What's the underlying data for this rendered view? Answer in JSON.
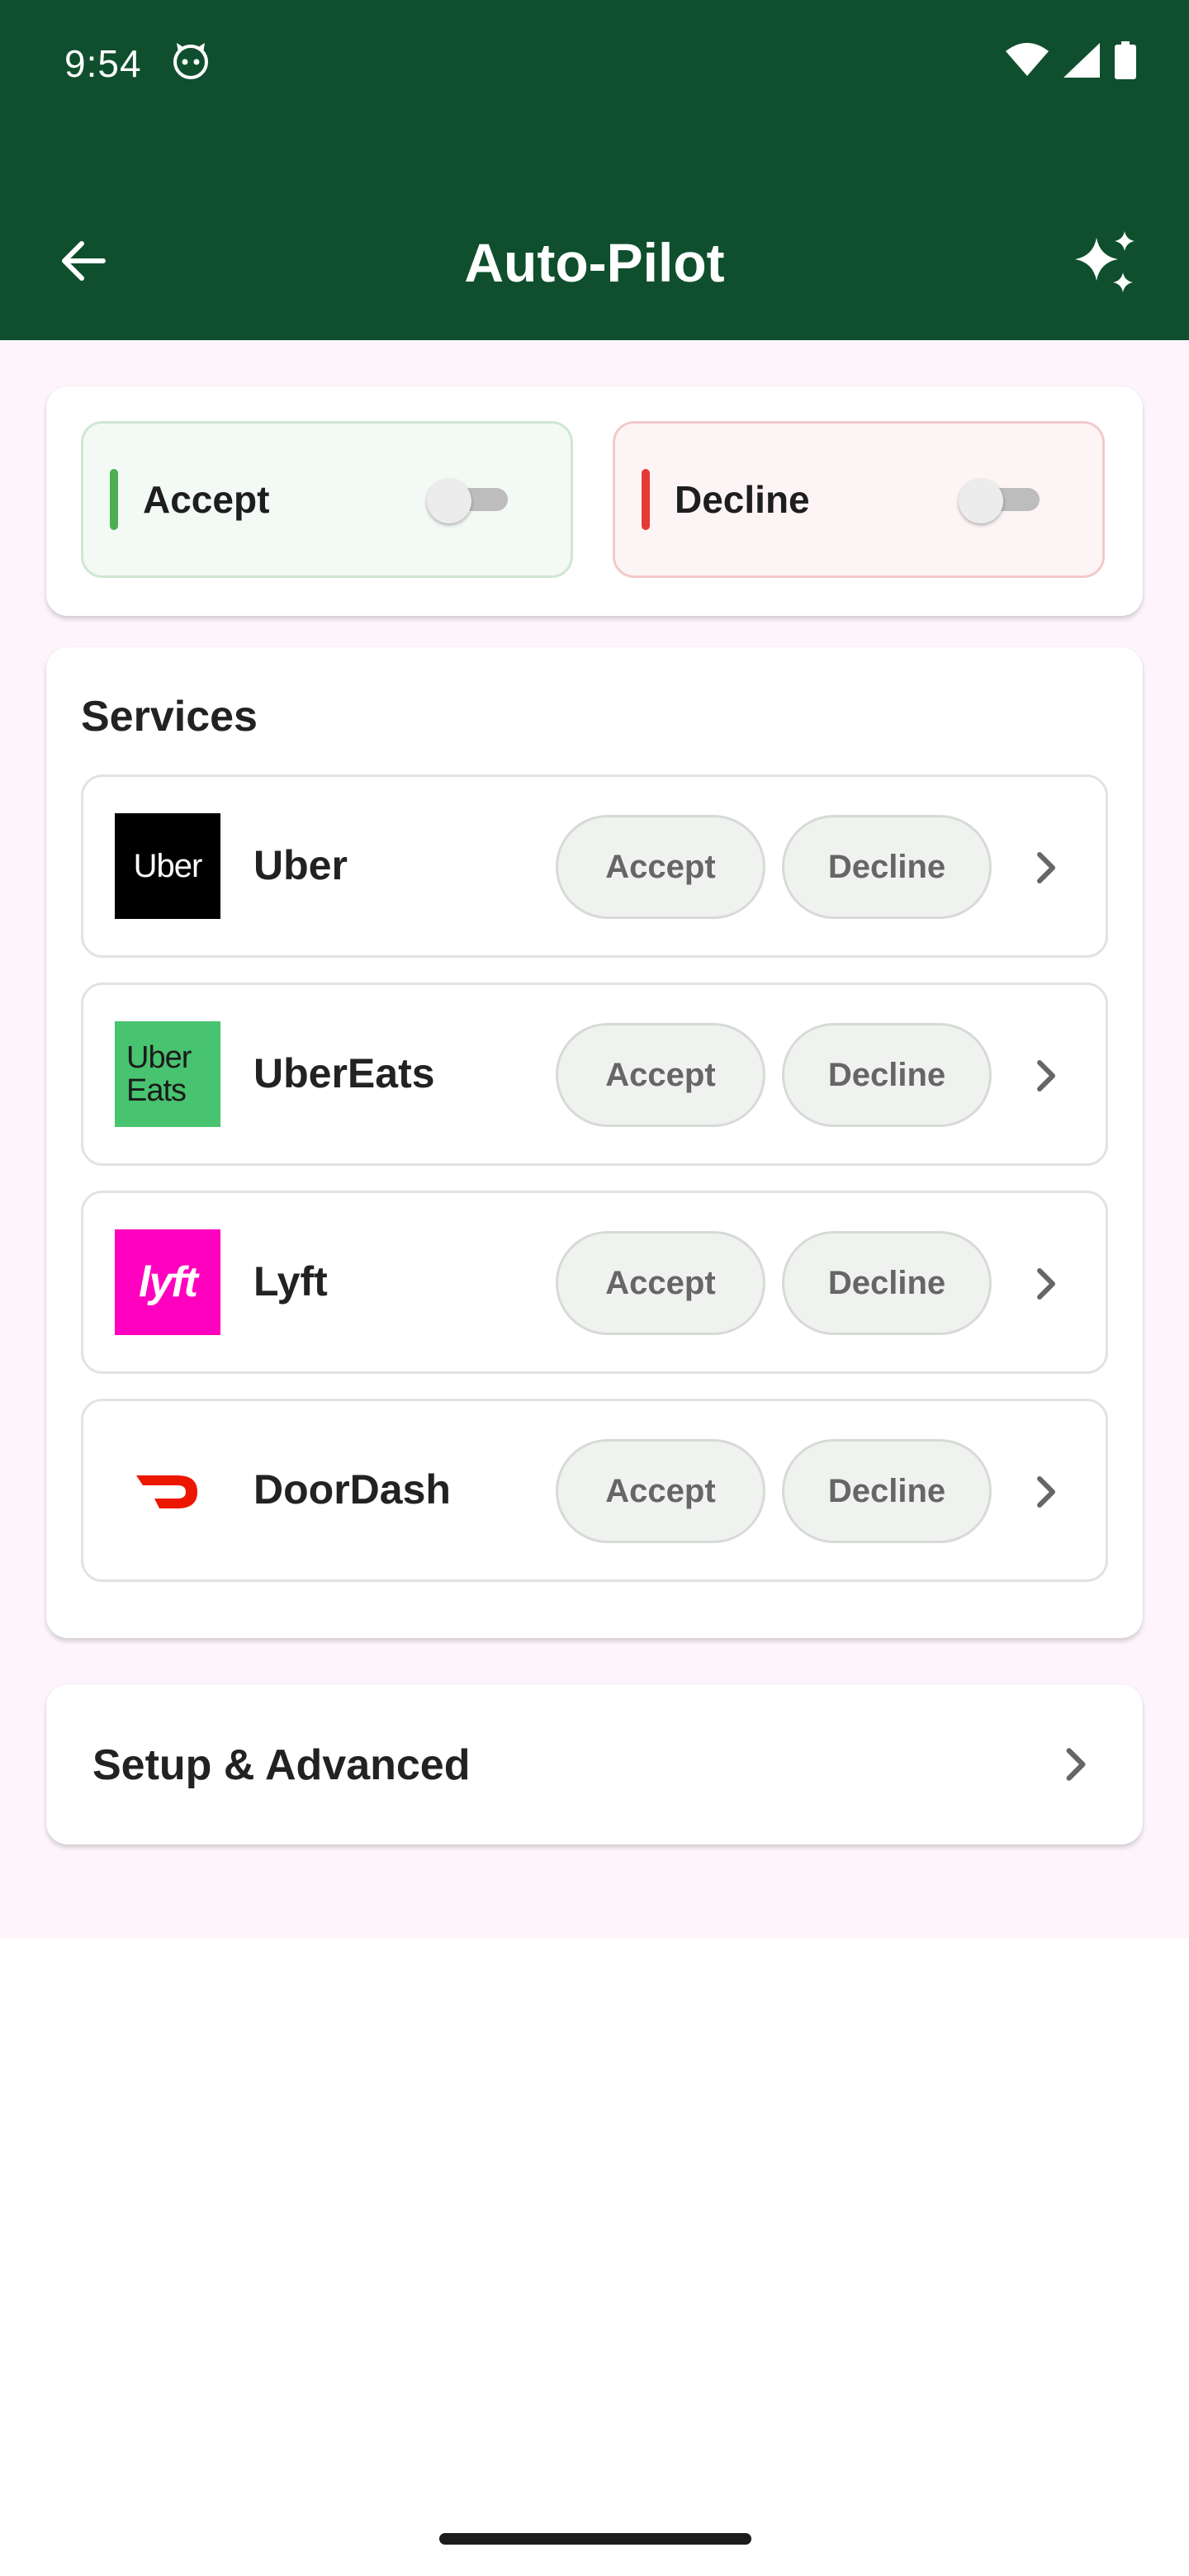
{
  "status_bar": {
    "time": "9:54",
    "icons": [
      "cat-face-icon",
      "wifi-icon",
      "signal-icon",
      "battery-icon"
    ]
  },
  "header": {
    "title": "Auto-Pilot",
    "back_icon": "arrow-left-icon",
    "action_icon": "sparkles-icon"
  },
  "master_toggles": {
    "accept": {
      "label": "Accept",
      "enabled": false,
      "accent_color": "#4caf50"
    },
    "decline": {
      "label": "Decline",
      "enabled": false,
      "accent_color": "#e53935"
    }
  },
  "services": {
    "title": "Services",
    "items": [
      {
        "name": "Uber",
        "logo_text": "Uber",
        "accept_label": "Accept",
        "decline_label": "Decline"
      },
      {
        "name": "UberEats",
        "logo_text": "Uber Eats",
        "logo_line1": "Uber",
        "logo_line2": "Eats",
        "accept_label": "Accept",
        "decline_label": "Decline"
      },
      {
        "name": "Lyft",
        "logo_text": "lyft",
        "accept_label": "Accept",
        "decline_label": "Decline"
      },
      {
        "name": "DoorDash",
        "logo_icon": "doordash-dash-icon",
        "accept_label": "Accept",
        "decline_label": "Decline"
      }
    ]
  },
  "setup": {
    "label": "Setup & Advanced"
  },
  "colors": {
    "header_bg": "#0f4f2d",
    "content_bg": "#fdf5fb",
    "uber_eats_green": "#48c36f",
    "lyft_pink": "#ff00bf",
    "doordash_red": "#eb1700"
  }
}
